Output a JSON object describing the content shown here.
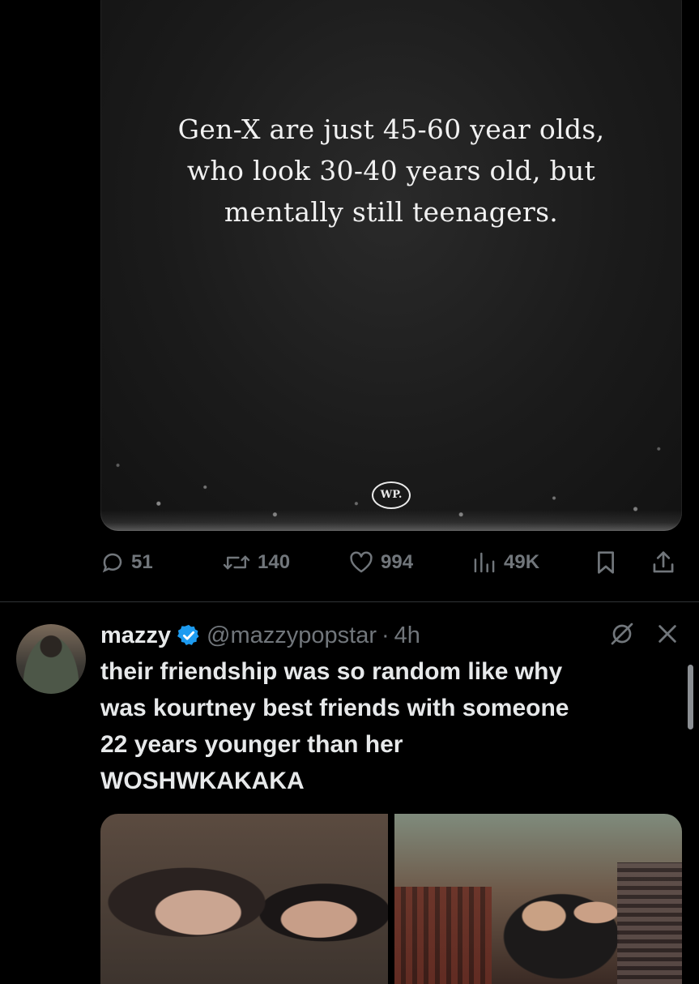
{
  "first_tweet": {
    "image": {
      "quote_text": "Gen-X are just 45-60 year olds,\nwho look 30-40 years old, but\nmentally still teenagers.",
      "logo_text": "WP."
    },
    "actions": {
      "replies": "51",
      "reposts": "140",
      "likes": "994",
      "views": "49K"
    }
  },
  "second_tweet": {
    "display_name": "mazzy",
    "handle": "@mazzypopstar",
    "separator": "·",
    "time": "4h",
    "text": "their friendship was so random like why\nwas kourtney best friends with someone\n22 years younger than her\nWOSHWKAKAKA"
  },
  "colors": {
    "background": "#000000",
    "text_primary": "#e7e9ea",
    "text_secondary": "#71767b",
    "verified_blue": "#1d9bf0",
    "divider": "#2f3336"
  },
  "icons": {
    "reply": "speech-bubble-icon",
    "repost": "repost-arrows-icon",
    "like": "heart-icon",
    "views": "bar-chart-icon",
    "bookmark": "bookmark-icon",
    "share": "share-upload-icon",
    "verified": "verified-badge-icon",
    "not_interested": "slashed-circle-icon",
    "close": "close-x-icon"
  }
}
